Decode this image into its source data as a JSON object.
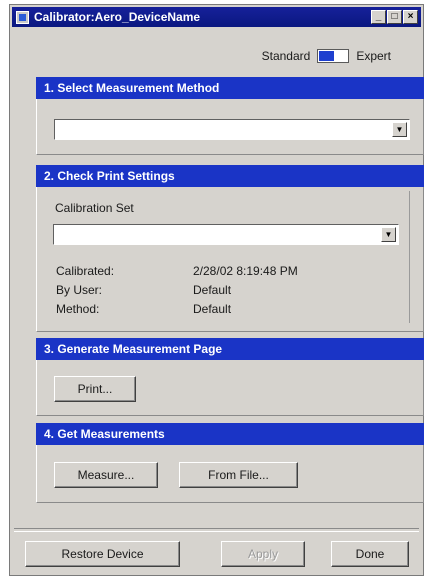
{
  "window": {
    "title": "Calibrator:Aero_DeviceName",
    "controls": {
      "minimize": "_",
      "maximize": "□",
      "close": "×"
    }
  },
  "mode": {
    "left_label": "Standard",
    "right_label": "Expert",
    "selected": "Standard"
  },
  "sections": {
    "s1": {
      "header": "1. Select Measurement Method",
      "combo_value": ""
    },
    "s2": {
      "header": "2. Check Print Settings",
      "calibration_set_label": "Calibration Set",
      "combo_value": "",
      "info": [
        {
          "label": "Calibrated:",
          "value": "2/28/02 8:19:48 PM"
        },
        {
          "label": "By User:",
          "value": "Default"
        },
        {
          "label": "Method:",
          "value": "Default"
        }
      ]
    },
    "s3": {
      "header": "3. Generate Measurement Page",
      "print_label": "Print..."
    },
    "s4": {
      "header": "4. Get Measurements",
      "measure_label": "Measure...",
      "from_file_label": "From File..."
    }
  },
  "footer": {
    "restore_label": "Restore Device",
    "apply_label": "Apply",
    "done_label": "Done"
  },
  "colors": {
    "title_bar": "#0a1780",
    "section_header": "#1a34c6",
    "toggle_knob": "#1e3fcf",
    "face": "#d6d3ce"
  },
  "icons": {
    "app": "calibrator-app-icon",
    "dropdown": "chevron-down-icon"
  }
}
